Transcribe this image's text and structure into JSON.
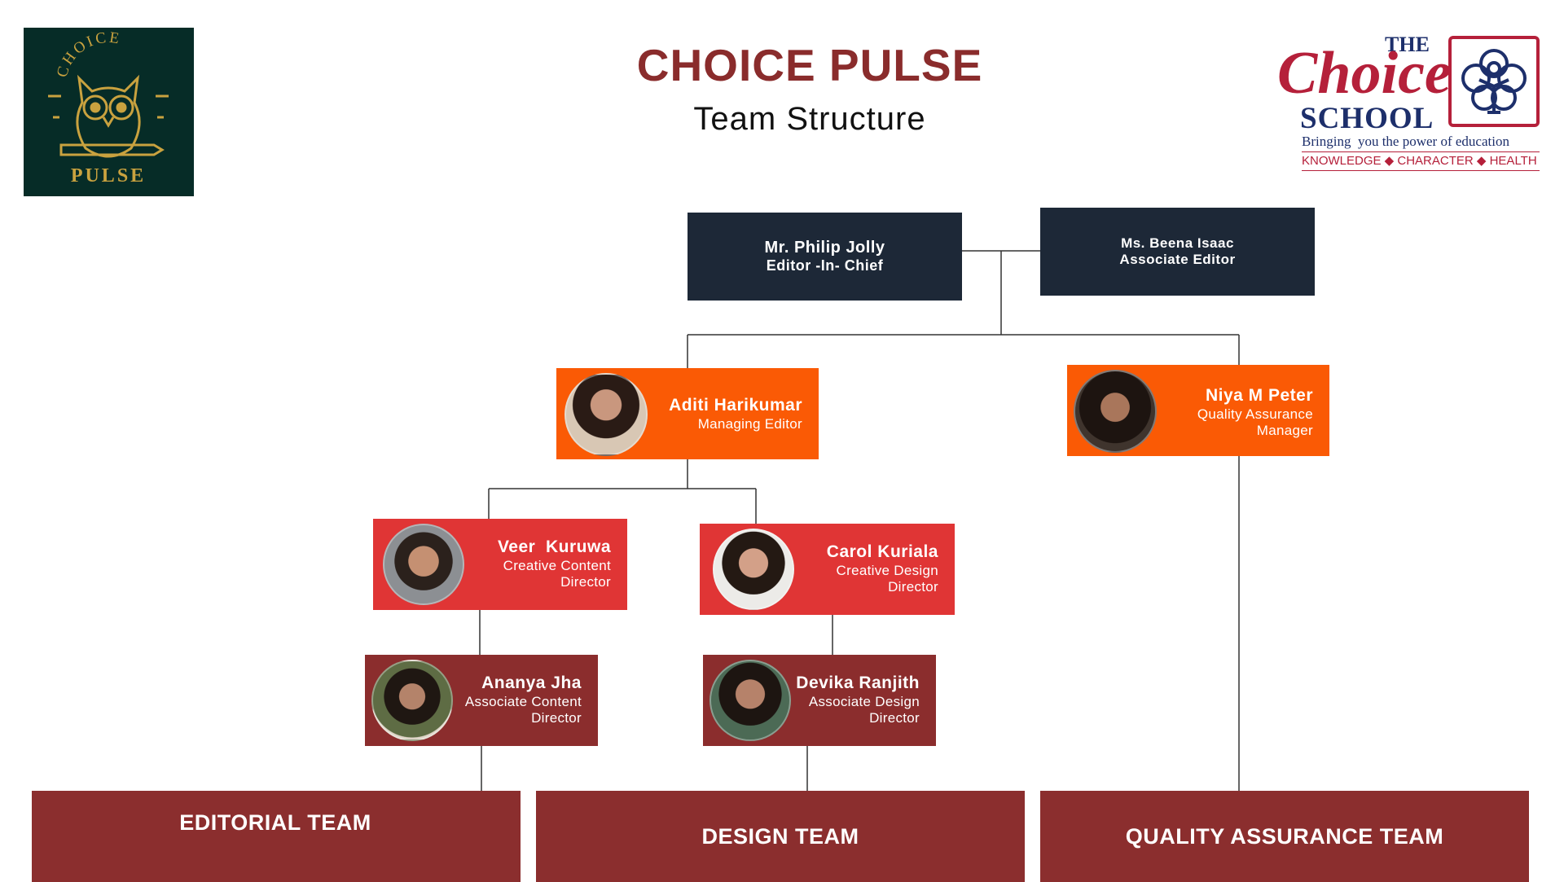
{
  "header": {
    "title": "CHOICE PULSE",
    "subtitle": "Team Structure"
  },
  "logos": {
    "pulse": {
      "arc_text": "CHOICE",
      "word": "PULSE",
      "bg": "#062c27",
      "accent": "#c9a23f"
    },
    "school": {
      "the": "THE",
      "choice": "Choice",
      "school": "SCHOOL",
      "tagline": "Bringing  you the power of education",
      "pillars": "KNOWLEDGE ◆ CHARACTER ◆ HEALTH",
      "accent": "#b5203a",
      "navy": "#1d2f6b"
    }
  },
  "colors": {
    "title": "#8a2c2c",
    "navy": "#1d2837",
    "orange": "#fa5a05",
    "red": "#e03535",
    "maroon": "#8b2d2d"
  },
  "nodes": {
    "editor_in_chief": {
      "name": "Mr. Philip Jolly",
      "role": "Editor -In- Chief"
    },
    "associate_editor": {
      "name": "Ms. Beena Isaac",
      "role": "Associate Editor"
    },
    "managing_editor": {
      "name": "Aditi Harikumar",
      "role": "Managing Editor"
    },
    "qa_manager": {
      "name": "Niya M Peter",
      "role_line1": "Quality Assurance",
      "role_line2": "Manager"
    },
    "creative_content": {
      "name": "Veer  Kuruwa",
      "role_line1": "Creative Content",
      "role_line2": "Director"
    },
    "creative_design": {
      "name": "Carol Kuriala",
      "role_line1": "Creative Design",
      "role_line2": "Director"
    },
    "assoc_content": {
      "name": "Ananya Jha",
      "role_line1": "Associate Content",
      "role_line2": "Director"
    },
    "assoc_design": {
      "name": "Devika Ranjith",
      "role_line1": "Associate Design",
      "role_line2": "Director"
    }
  },
  "teams": {
    "editorial": "EDITORIAL TEAM",
    "design": "DESIGN TEAM",
    "qa": "QUALITY ASSURANCE TEAM"
  }
}
